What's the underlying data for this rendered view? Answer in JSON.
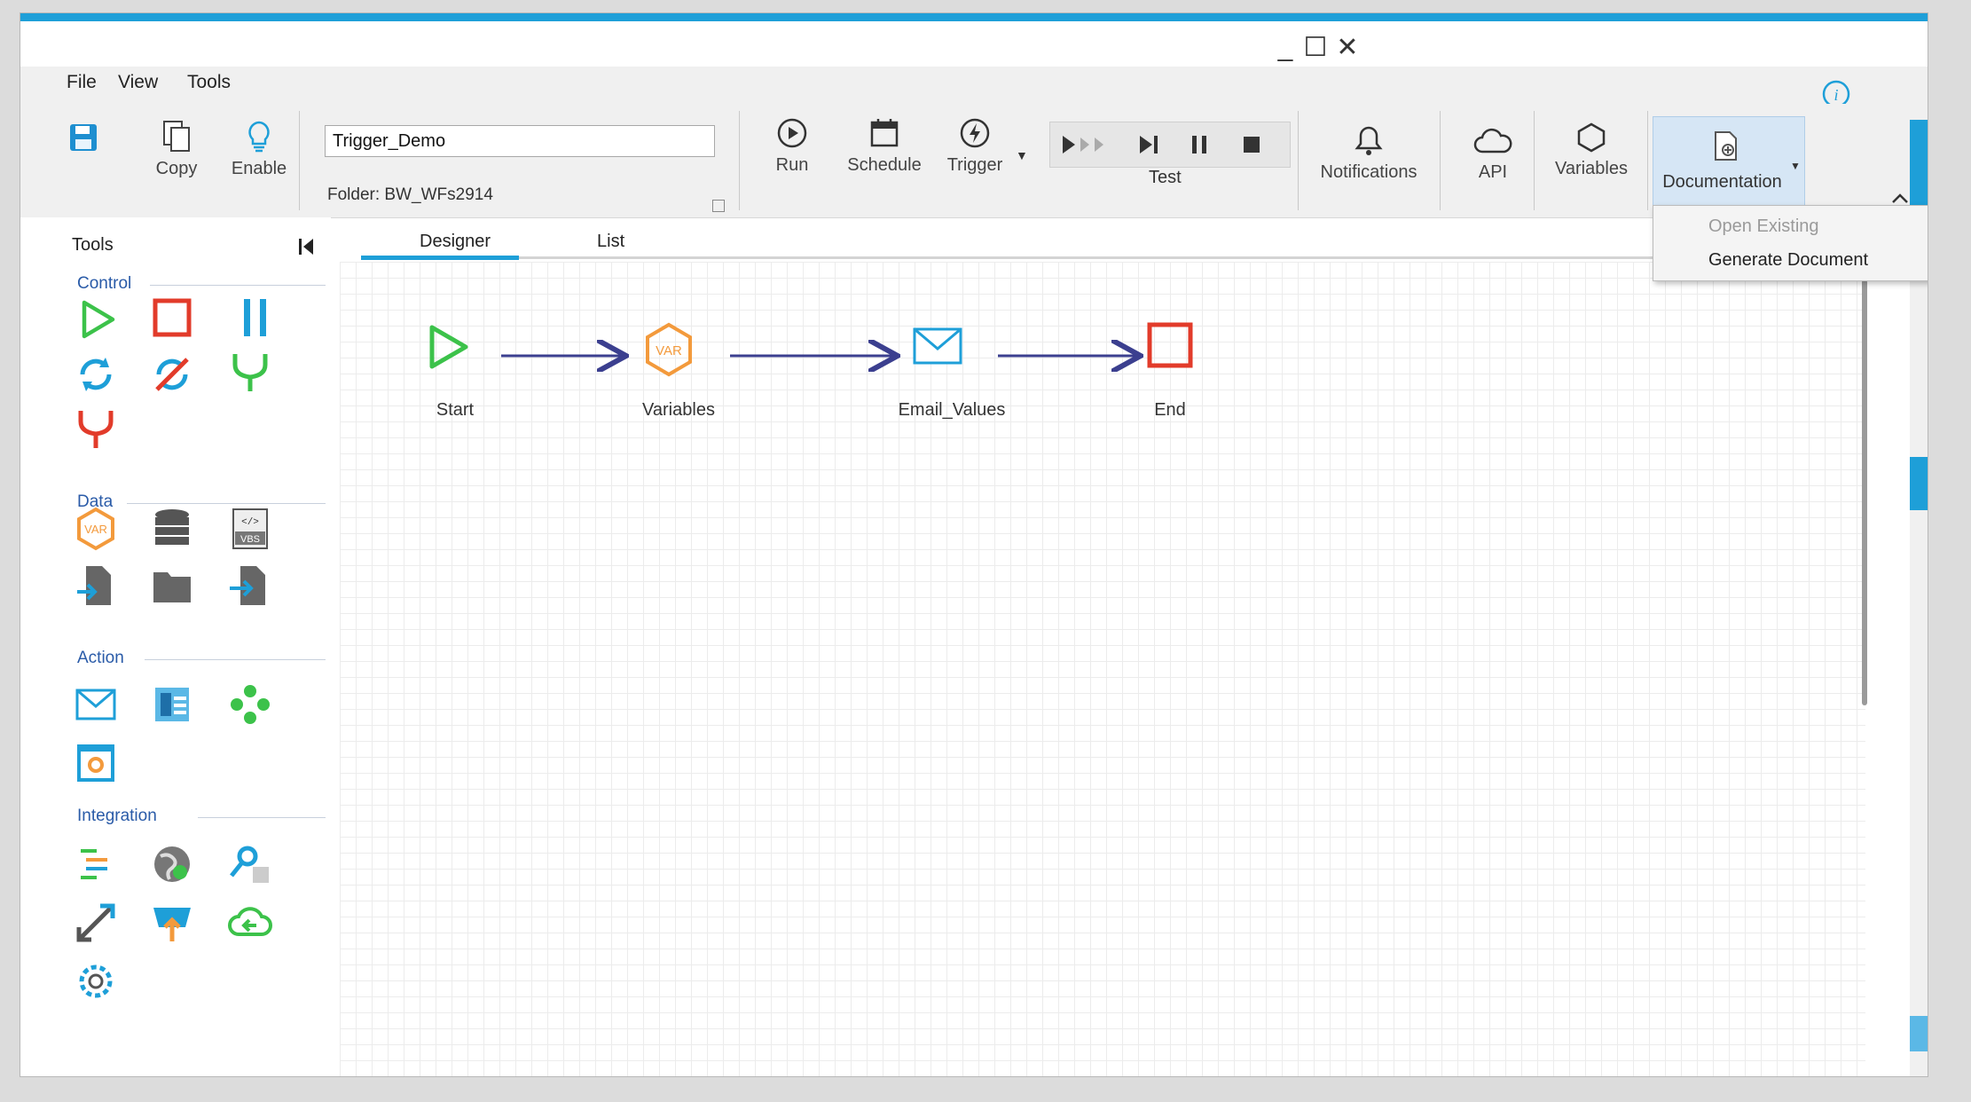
{
  "window": {
    "controls": {
      "minimize": "_",
      "maximize": "☐",
      "close": "✕"
    }
  },
  "menu": {
    "items": [
      "File",
      "View",
      "Tools"
    ]
  },
  "ribbon": {
    "save_label": "",
    "copy_label": "Copy",
    "enable_label": "Enable",
    "workflow_name": "Trigger_Demo",
    "folder_label": "Folder:  BW_WFs2914",
    "run_label": "Run",
    "schedule_label": "Schedule",
    "trigger_label": "Trigger",
    "test_label": "Test",
    "notifications_label": "Notifications",
    "api_label": "API",
    "variables_label": "Variables",
    "documentation_label": "Documentation"
  },
  "documentation_menu": {
    "items": [
      {
        "label": "Open Existing",
        "enabled": false
      },
      {
        "label": "Generate Document",
        "enabled": true
      }
    ]
  },
  "tools_panel": {
    "title": "Tools",
    "sections": {
      "control": "Control",
      "data": "Data",
      "action": "Action",
      "integration": "Integration"
    }
  },
  "tabs": {
    "designer": "Designer",
    "list": "List",
    "active": "Designer"
  },
  "workflow": {
    "nodes": [
      {
        "label": "Start",
        "icon": "play-icon"
      },
      {
        "label": "Variables",
        "icon": "var-hexagon-icon"
      },
      {
        "label": "Email_Values",
        "icon": "envelope-icon"
      },
      {
        "label": "End",
        "icon": "stop-square-icon"
      }
    ]
  },
  "colors": {
    "accent": "#1e9fd8",
    "start_green": "#3cc24a",
    "end_red": "#e23b2a",
    "var_orange": "#f39a3c",
    "arrow": "#3b3f8f",
    "section_blue": "#2a5ba8"
  }
}
